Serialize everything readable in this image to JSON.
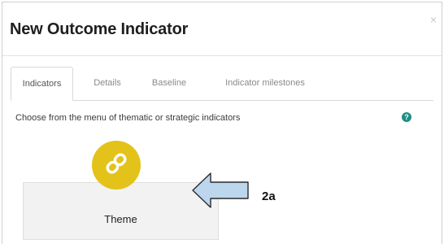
{
  "dialog": {
    "title": "New Outcome Indicator",
    "close_label": "×"
  },
  "tabs": [
    {
      "label": "Indicators",
      "active": true
    },
    {
      "label": "Details",
      "active": false
    },
    {
      "label": "Baseline",
      "active": false
    },
    {
      "label": "Indicator milestones",
      "active": false
    }
  ],
  "content": {
    "instruction": "Choose from the menu of thematic or strategic indicators",
    "help_icon_glyph": "?",
    "cards": [
      {
        "label": "Theme",
        "icon": "link-icon",
        "badge_color": "#e3c21a"
      }
    ]
  },
  "annotation": {
    "label": "2a",
    "arrow_color": "#bcd6ee"
  }
}
